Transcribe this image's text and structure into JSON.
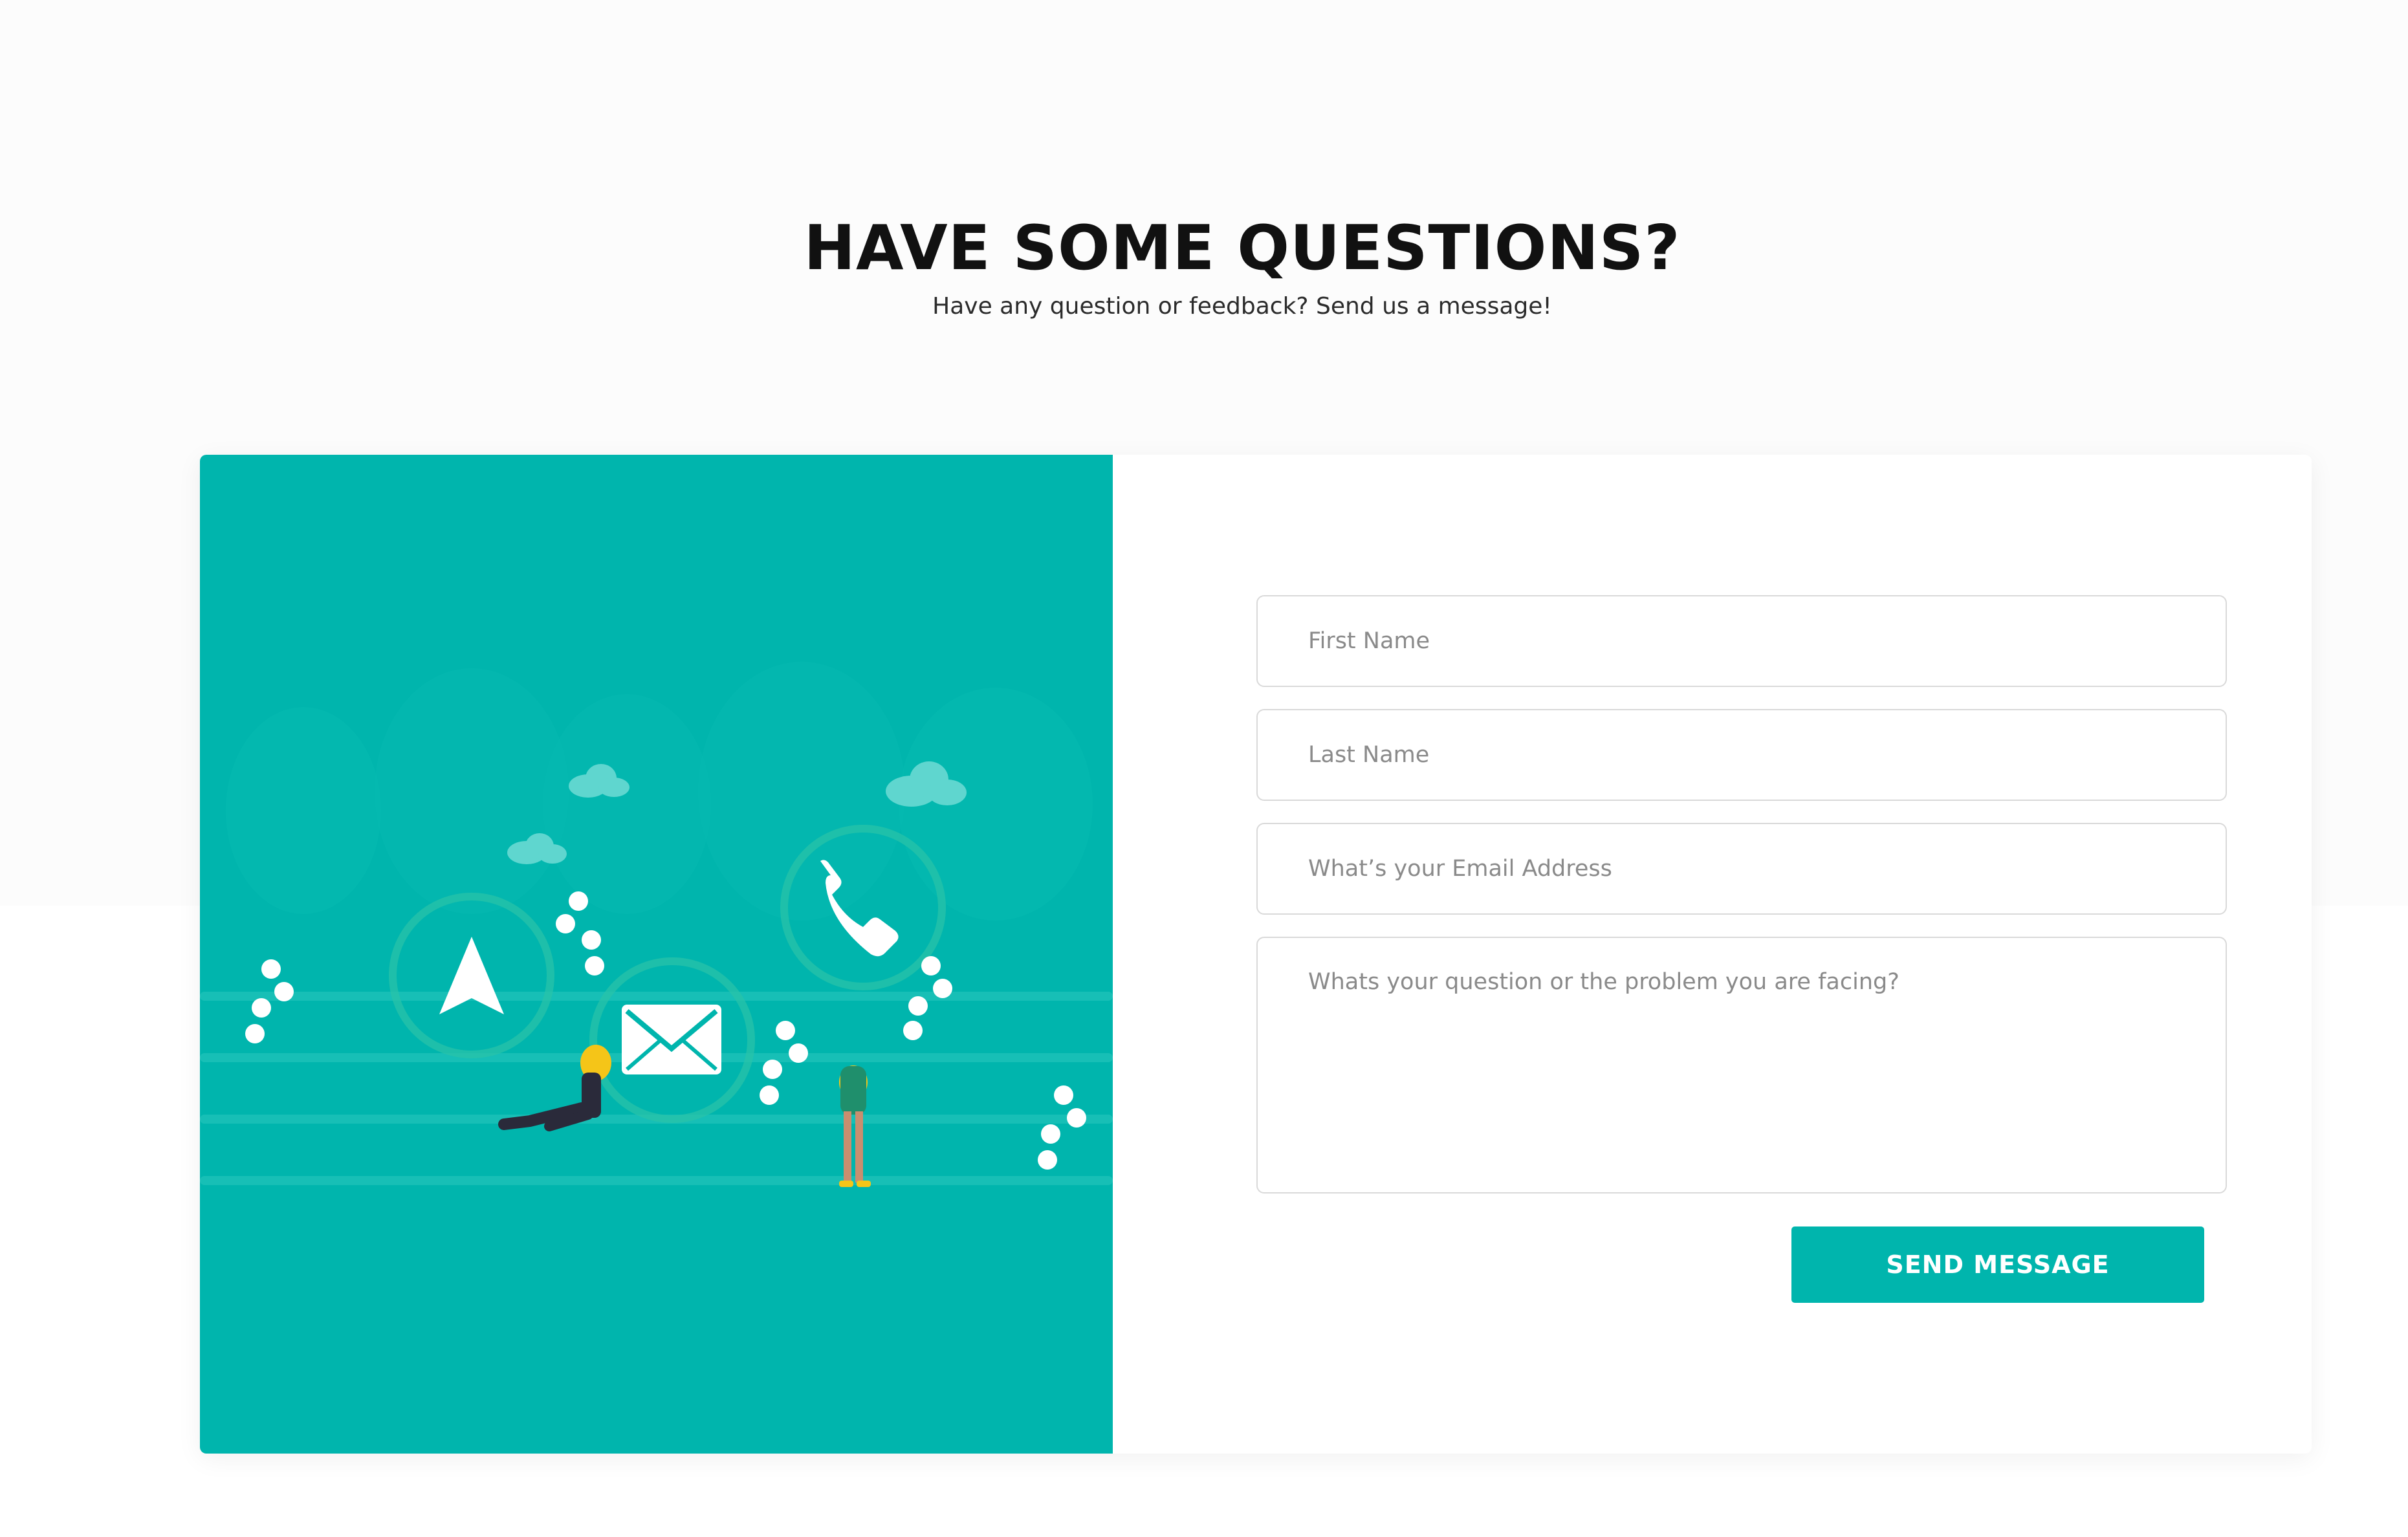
{
  "header": {
    "title": "HAVE SOME QUESTIONS?",
    "subtitle": "Have any question or feedback? Send us a message!"
  },
  "illustration": {
    "background_color": "#00b5ad",
    "icons": [
      "navigation-arrow-icon",
      "envelope-icon",
      "phone-icon"
    ]
  },
  "form": {
    "first_name_placeholder": "First Name",
    "last_name_placeholder": "Last Name",
    "email_placeholder": "What’s your Email Address",
    "message_placeholder": "Whats your question or the problem you are facing?",
    "submit_label": "SEND MESSAGE"
  },
  "colors": {
    "accent": "#00b5ad",
    "heading": "#111111",
    "field_border": "#d9d9d9"
  }
}
